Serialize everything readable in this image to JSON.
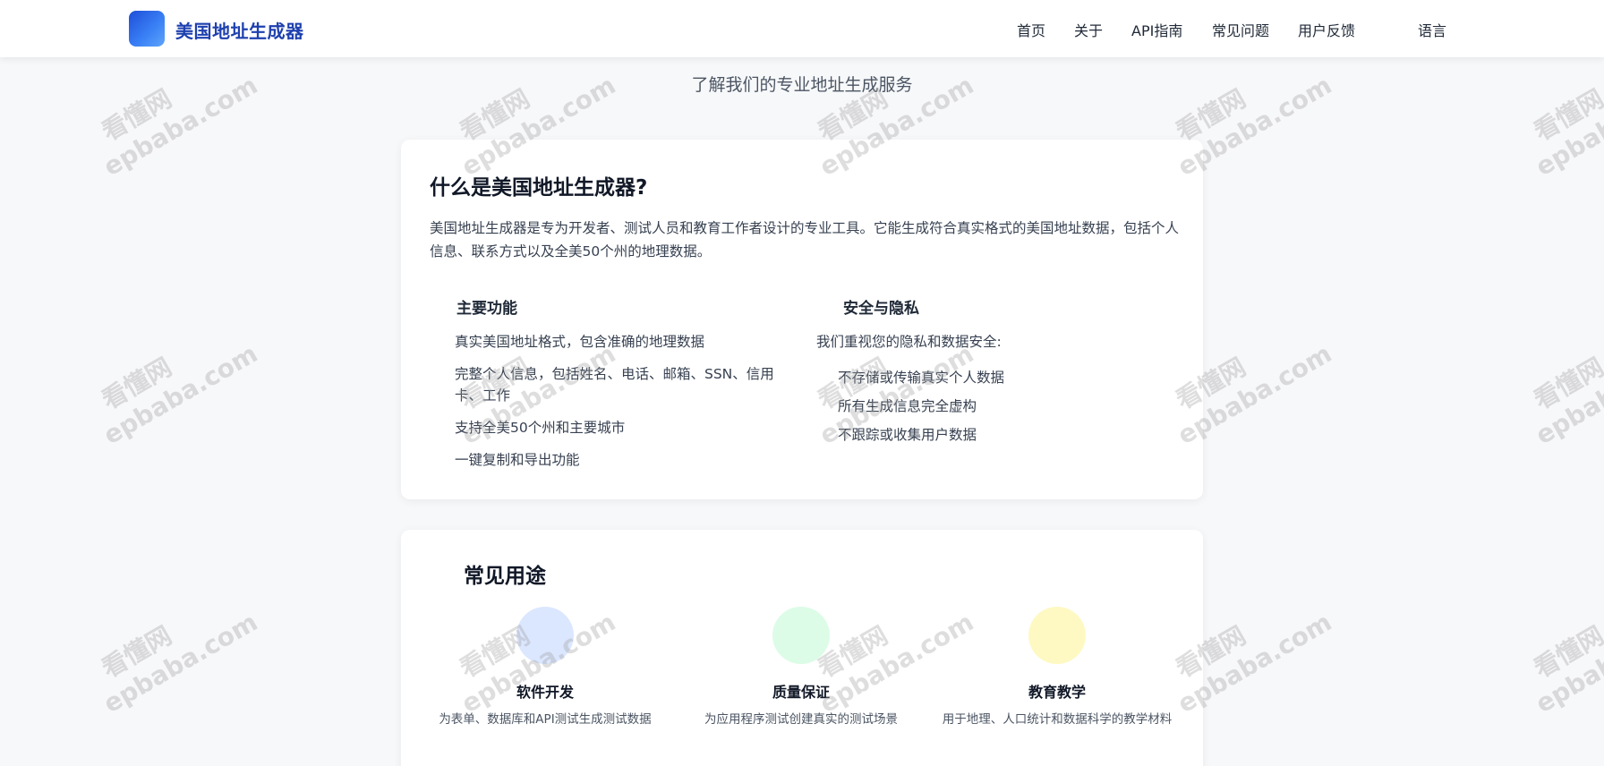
{
  "header": {
    "brand": "美国地址生成器",
    "nav": [
      "首页",
      "关于",
      "API指南",
      "常见问题",
      "用户反馈",
      "语言"
    ]
  },
  "hero": {
    "subtitle": "了解我们的专业地址生成服务"
  },
  "about": {
    "title": "什么是美国地址生成器?",
    "description": "美国地址生成器是专为开发者、测试人员和教育工作者设计的专业工具。它能生成符合真实格式的美国地址数据，包括个人信息、联系方式以及全美50个州的地理数据。",
    "features": {
      "title": "主要功能",
      "items": [
        "真实美国地址格式，包含准确的地理数据",
        "完整个人信息，包括姓名、电话、邮箱、SSN、信用卡、工作",
        "支持全美50个州和主要城市",
        "一键复制和导出功能"
      ]
    },
    "privacy": {
      "title": "安全与隐私",
      "intro": "我们重视您的隐私和数据安全:",
      "items": [
        "不存储或传输真实个人数据",
        "所有生成信息完全虚构",
        "不跟踪或收集用户数据"
      ]
    }
  },
  "uses": {
    "title": "常见用途",
    "items": [
      {
        "title": "软件开发",
        "desc": "为表单、数据库和API测试生成测试数据",
        "color": "#dbe7ff"
      },
      {
        "title": "质量保证",
        "desc": "为应用程序测试创建真实的测试场景",
        "color": "#dcfce7"
      },
      {
        "title": "教育教学",
        "desc": "用于地理、人口统计和数据科学的教学材料",
        "color": "#fef9c3"
      }
    ]
  },
  "watermark": {
    "line1": "看懂网",
    "line2": "epbaba.com"
  },
  "colors": {
    "brand": "#1e40af",
    "accent": "#3b82f6",
    "background": "#f7f8fa"
  }
}
